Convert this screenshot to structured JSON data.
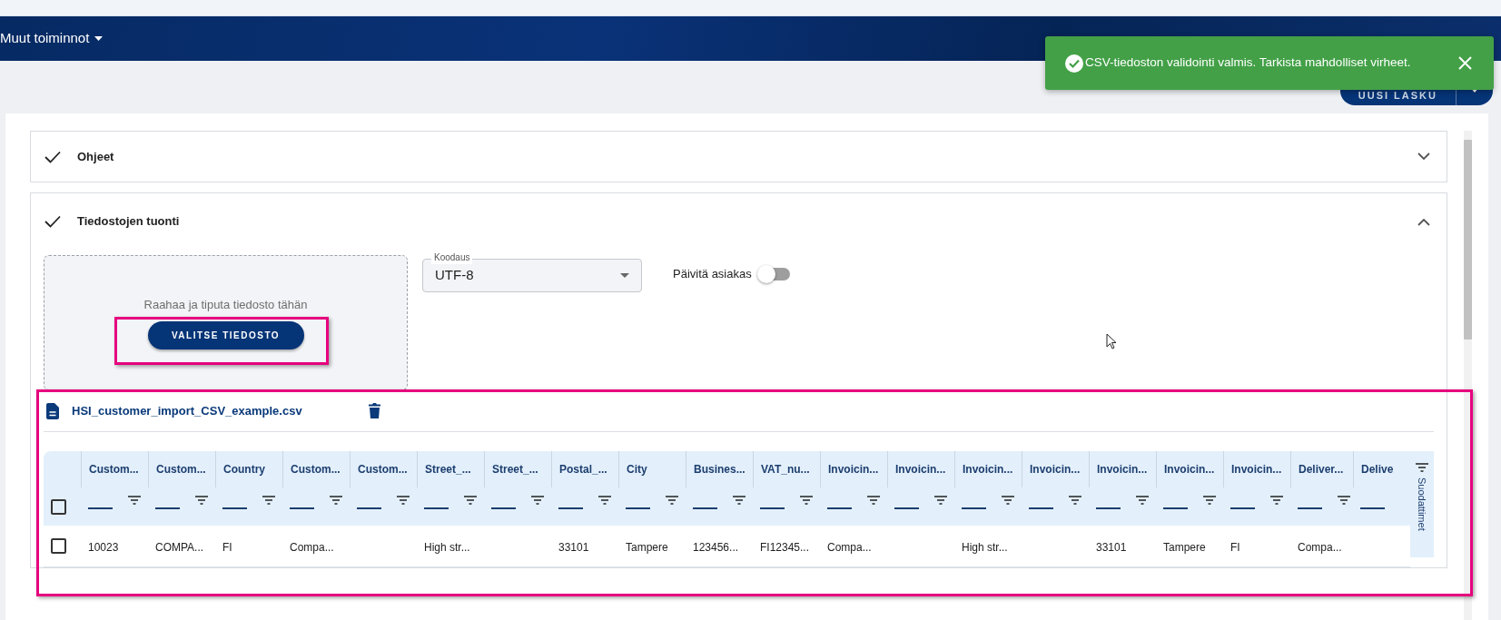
{
  "nav": {
    "menu": "Muut toiminnot"
  },
  "new_invoice_button": {
    "label": "UUSI LASKU"
  },
  "toast": {
    "message": "CSV-tiedoston validointi valmis. Tarkista mahdolliset virheet."
  },
  "sections": [
    {
      "title": "Ohjeet",
      "done": true,
      "expanded": false
    },
    {
      "title": "Tiedostojen tuonti",
      "done": true,
      "expanded": true
    }
  ],
  "dropzone": {
    "hint": "Raahaa ja tiputa tiedosto tähän",
    "button": "VALITSE TIEDOSTO"
  },
  "encoding": {
    "label": "Koodaus",
    "value": "UTF-8"
  },
  "update_customer": {
    "label": "Päivitä asiakas",
    "on": false
  },
  "file": {
    "name": "HSI_customer_import_CSV_example.csv"
  },
  "table": {
    "select_all": false,
    "columns": [
      "Custom...",
      "Custom...",
      "Country",
      "Custom...",
      "Custom...",
      "Street_...",
      "Street_...",
      "Postal_...",
      "City",
      "Busines...",
      "VAT_nu...",
      "Invoicin...",
      "Invoicin...",
      "Invoicin...",
      "Invoicin...",
      "Invoicin...",
      "Invoicin...",
      "Invoicin...",
      "Deliver...",
      "Delive"
    ],
    "rows": [
      {
        "selected": false,
        "cells": [
          "10023",
          "COMPA...",
          "FI",
          "Compa...",
          null,
          "High str...",
          null,
          "33101",
          "Tampere",
          "123456...",
          "FI12345...",
          "Compa...",
          null,
          "High str...",
          null,
          "33101",
          "Tampere",
          "FI",
          "Compa...",
          null
        ]
      }
    ]
  },
  "filters_panel": {
    "label": "Suodattimet"
  }
}
